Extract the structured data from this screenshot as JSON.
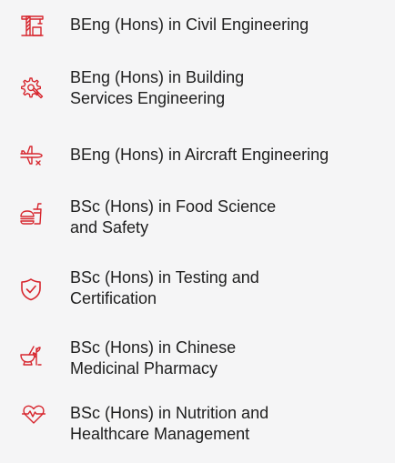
{
  "theme": {
    "accent": "#d7262e",
    "background": "#f5f5f6",
    "text": "#1e1e1e"
  },
  "programmes": [
    {
      "icon": "construction-crane-icon",
      "label": "BEng (Hons) in Civil Engineering"
    },
    {
      "icon": "gear-tools-icon",
      "label": "BEng (Hons) in Building\nServices Engineering"
    },
    {
      "icon": "airplane-icon",
      "label": "BEng (Hons) in Aircraft Engineering"
    },
    {
      "icon": "food-burger-drink-icon",
      "label": "BSc (Hons) in Food Science\nand Safety"
    },
    {
      "icon": "shield-check-icon",
      "label": "BSc (Hons) in Testing and\nCertification"
    },
    {
      "icon": "mortar-pestle-herbs-icon",
      "label": "BSc (Hons) in Chinese\nMedicinal Pharmacy"
    },
    {
      "icon": "heart-pulse-icon",
      "label": "BSc (Hons) in Nutrition and\nHealthcare Management"
    }
  ]
}
